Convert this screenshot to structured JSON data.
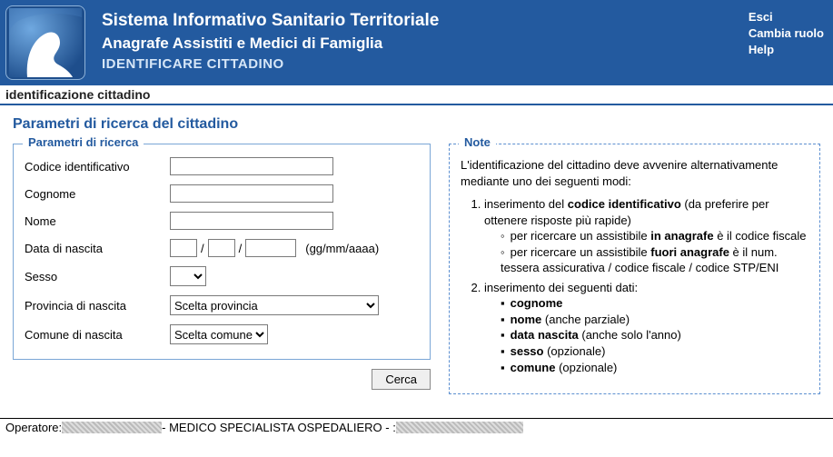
{
  "header": {
    "title1": "Sistema Informativo Sanitario Territoriale",
    "title2": "Anagrafe Assistiti e Medici di Famiglia",
    "title3": "IDENTIFICARE CITTADINO",
    "links": {
      "esci": "Esci",
      "cambia": "Cambia ruolo",
      "help": "Help"
    }
  },
  "subheader": "identificazione cittadino",
  "page_title": "Parametri di ricerca del cittadino",
  "search": {
    "legend": "Parametri di ricerca",
    "codice_label": "Codice identificativo",
    "cognome_label": "Cognome",
    "nome_label": "Nome",
    "data_label": "Data di nascita",
    "data_hint": "(gg/mm/aaaa)",
    "sesso_label": "Sesso",
    "provincia_label": "Provincia di nascita",
    "provincia_selected": "Scelta provincia",
    "comune_label": "Comune di nascita",
    "comune_selected": "Scelta comune"
  },
  "notes": {
    "legend": "Note",
    "intro": "L'identificazione del cittadino deve avvenire alternativamente mediante uno dei seguenti modi:",
    "item1_pre": "inserimento del ",
    "item1_bold": "codice identificativo",
    "item1_post": " (da preferire per ottenere risposte più rapide)",
    "sub1a_pre": "per ricercare un assistibile ",
    "sub1a_bold": "in anagrafe",
    "sub1a_post": " è il codice fiscale",
    "sub1b_pre": "per ricercare un assistibile ",
    "sub1b_bold": "fuori anagrafe",
    "sub1b_post": " è il num. tessera assicurativa / codice fiscale / codice STP/ENI",
    "item2": "inserimento dei seguenti dati:",
    "d_cognome": "cognome",
    "d_nome_b": "nome",
    "d_nome_post": " (anche parziale)",
    "d_data_b": "data nascita",
    "d_data_post": " (anche solo l'anno)",
    "d_sesso_b": "sesso",
    "d_sesso_post": " (opzionale)",
    "d_comune_b": "comune",
    "d_comune_post": " (opzionale)"
  },
  "actions": {
    "cerca": "Cerca"
  },
  "footer": {
    "operatore_label": "Operatore: ",
    "role": " - MEDICO SPECIALISTA OSPEDALIERO - : "
  }
}
